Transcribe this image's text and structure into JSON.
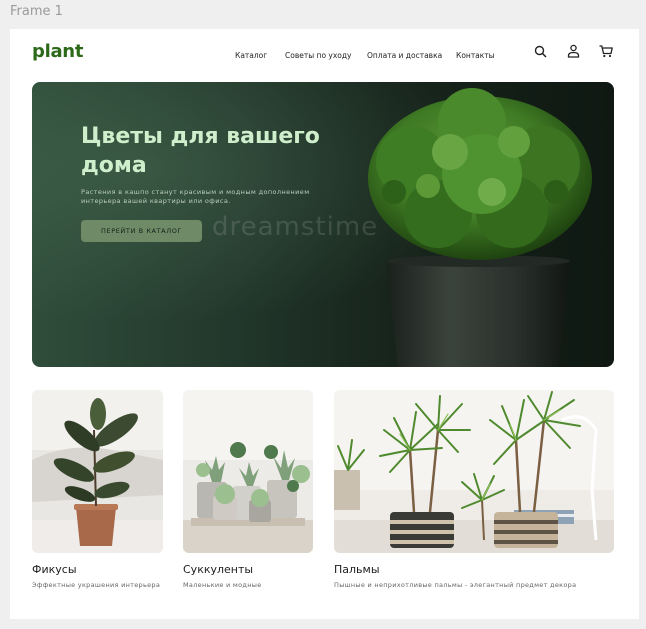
{
  "frame_label": "Frame 1",
  "header": {
    "logo": "plant",
    "nav": [
      "Каталог",
      "Советы по уходу",
      "Оплата и доставка",
      "Контакты"
    ],
    "icons": [
      "search-icon",
      "user-icon",
      "cart-icon"
    ]
  },
  "hero": {
    "title": "Цветы для вашего дома",
    "subtitle": "Растения в кашпо станут красивым и модным дополнением интерьера вашей квартиры или офиса.",
    "button": "ПЕРЕЙТИ В КАТАЛОГ",
    "watermark": "dreamstime"
  },
  "categories": [
    {
      "name": "Фикусы",
      "desc": "Эффектные украшения интерьера"
    },
    {
      "name": "Суккуленты",
      "desc": "Маленькие и модные"
    },
    {
      "name": "Пальмы",
      "desc": "Пышные и неприхотливые пальмы - элегантный предмет декора"
    }
  ],
  "colors": {
    "accent": "#2c6a1a",
    "hero_bg": "#1b2a20",
    "hero_title": "#cfeecb",
    "button": "#6e8a66"
  }
}
